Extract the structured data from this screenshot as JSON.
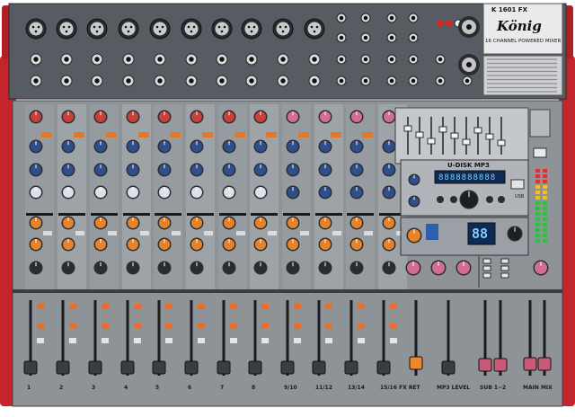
{
  "header": {
    "brand": "König",
    "model": "K 1601 FX",
    "subtitle": "16 CHANNEL POWERED MIXER"
  },
  "mp3_player": {
    "title": "U-DISK MP3",
    "display": "8888888888",
    "usb_label": "USB",
    "effect_display": "88"
  },
  "channels": {
    "mono_labels": [
      "1",
      "2",
      "3",
      "4",
      "5",
      "6",
      "7",
      "8"
    ],
    "stereo_labels": [
      "9/10",
      "11/12",
      "13/14",
      "15/16"
    ]
  },
  "fader_section": {
    "fx_label": "FX  RET",
    "mp3_label": "MP3 LEVEL",
    "sub_label": "SUB 1~2",
    "main_label": "MAIN MIX"
  },
  "colors": {
    "body": "#8e9398",
    "top_panel": "#595e64",
    "side_rail": "#c4242b",
    "knob_orange": "#e8822a",
    "knob_blue": "#2f4f8c",
    "fader_cap": "#3a3d42",
    "fader_fx": "#f0862c",
    "fader_pink": "#c85a78",
    "display_bg": "#0f2a52",
    "display_text": "#7fd0ff"
  }
}
